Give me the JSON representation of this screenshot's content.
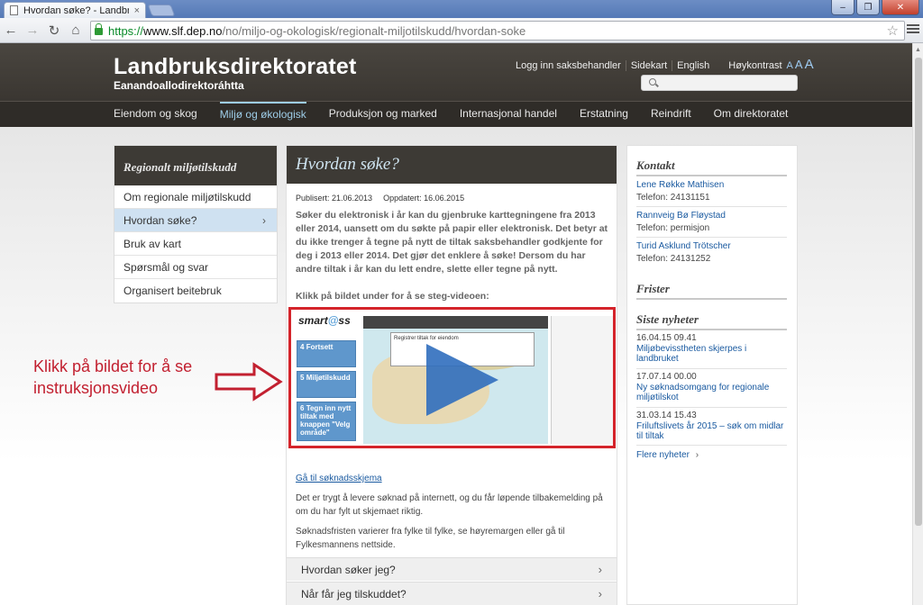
{
  "browser": {
    "tab_title": "Hvordan søke? - Landbruk",
    "tab_close": "×",
    "window_controls": [
      "–",
      "❐",
      "✕"
    ],
    "url_scheme": "https://",
    "url_host": "www.slf.dep.no",
    "url_path": "/no/miljo-og-okologisk/regionalt-miljotilskudd/hvordan-soke",
    "back_icon": "←",
    "forward_icon": "→",
    "reload_icon": "↻",
    "home_icon": "⌂",
    "star_icon": "☆"
  },
  "header": {
    "logo_main": "Landbruksdirektoratet",
    "logo_sub": "Eanandoallodirektoráhtta",
    "links": {
      "login": "Logg inn saksbehandler",
      "sitemap": "Sidekart",
      "english": "English",
      "contrast": "Høykontrast",
      "a_small": "A",
      "a_medium": "A",
      "a_large": "A"
    },
    "search_placeholder": ""
  },
  "mainnav": {
    "items": [
      {
        "label": "Eiendom og skog"
      },
      {
        "label": "Miljø og økologisk"
      },
      {
        "label": "Produksjon og marked"
      },
      {
        "label": "Internasjonal handel"
      },
      {
        "label": "Erstatning"
      },
      {
        "label": "Reindrift"
      },
      {
        "label": "Om direktoratet"
      }
    ],
    "active_index": 1
  },
  "sidebar": {
    "title": "Regionalt miljøtilskudd",
    "items": [
      {
        "label": "Om regionale miljøtilskudd"
      },
      {
        "label": "Hvordan søke?"
      },
      {
        "label": "Bruk av kart"
      },
      {
        "label": "Spørsmål og svar"
      },
      {
        "label": "Organisert beitebruk"
      }
    ],
    "selected_chevron": "›"
  },
  "article": {
    "title": "Hvordan søke?",
    "published": "Publisert: 21.06.2013",
    "updated": "Oppdatert: 16.06.2015",
    "lead": "Søker du elektronisk i år kan du gjenbruke karttegningene fra 2013 eller 2014, uansett om du søkte på papir eller elektronisk. Det betyr at du ikke trenger å tegne på nytt de tiltak saksbehandler godkjente for deg i 2013 eller 2014. Det gjør det enklere å søke! Dersom du har andre tiltak i år kan du lett endre, slette eller tegne på nytt.",
    "click_hint": "Klikk på bildet under for å se steg-videoen:",
    "video": {
      "brand": "smart",
      "brand_mid": "@",
      "brand_end": "ss",
      "steps": [
        {
          "num": "4",
          "label": "Fortsett"
        },
        {
          "num": "5",
          "label": "Miljøtilskudd"
        },
        {
          "num": "6",
          "label": "Tegn inn nytt tiltak med knappen \"Velg område\""
        }
      ],
      "dialog_text": "Registrer tiltak for eiendom"
    },
    "form_link": "Gå til søknadsskjema",
    "para1": "Det er trygt å levere søknad på internett, og du får løpende tilbakemelding på om du har fylt ut skjemaet riktig.",
    "para2": "Søknadsfristen varierer fra fylke til fylke, se høyremargen eller gå til Fylkesmannens nettside.",
    "accordion": [
      {
        "label": "Hvordan søker jeg?"
      },
      {
        "label": "Når får jeg tilskuddet?"
      }
    ],
    "chevron": "›"
  },
  "right": {
    "contact_title": "Kontakt",
    "contacts": [
      {
        "name": "Lene Røkke Mathisen",
        "phone": "Telefon: 24131151"
      },
      {
        "name": "Rannveig Bø Fløystad",
        "phone": "Telefon: permisjon"
      },
      {
        "name": "Turid Asklund Trötscher",
        "phone": "Telefon: 24131252"
      }
    ],
    "deadlines_title": "Frister",
    "news_title": "Siste nyheter",
    "news": [
      {
        "date": "16.04.15 09.41",
        "title": "Miljøbevisstheten skjerpes i landbruket"
      },
      {
        "date": "17.07.14 00.00",
        "title": "Ny søknadsomgang for regionale miljøtilskot"
      },
      {
        "date": "31.03.14 15.43",
        "title": "Friluftslivets år 2015 – søk om midlar til tiltak"
      }
    ],
    "more_news": "Flere nyheter",
    "more_chevron": "›"
  },
  "annotation": {
    "line1": "Klikk på bildet for å se",
    "line2": "instruksjonsvideo",
    "color": "#c22030"
  }
}
